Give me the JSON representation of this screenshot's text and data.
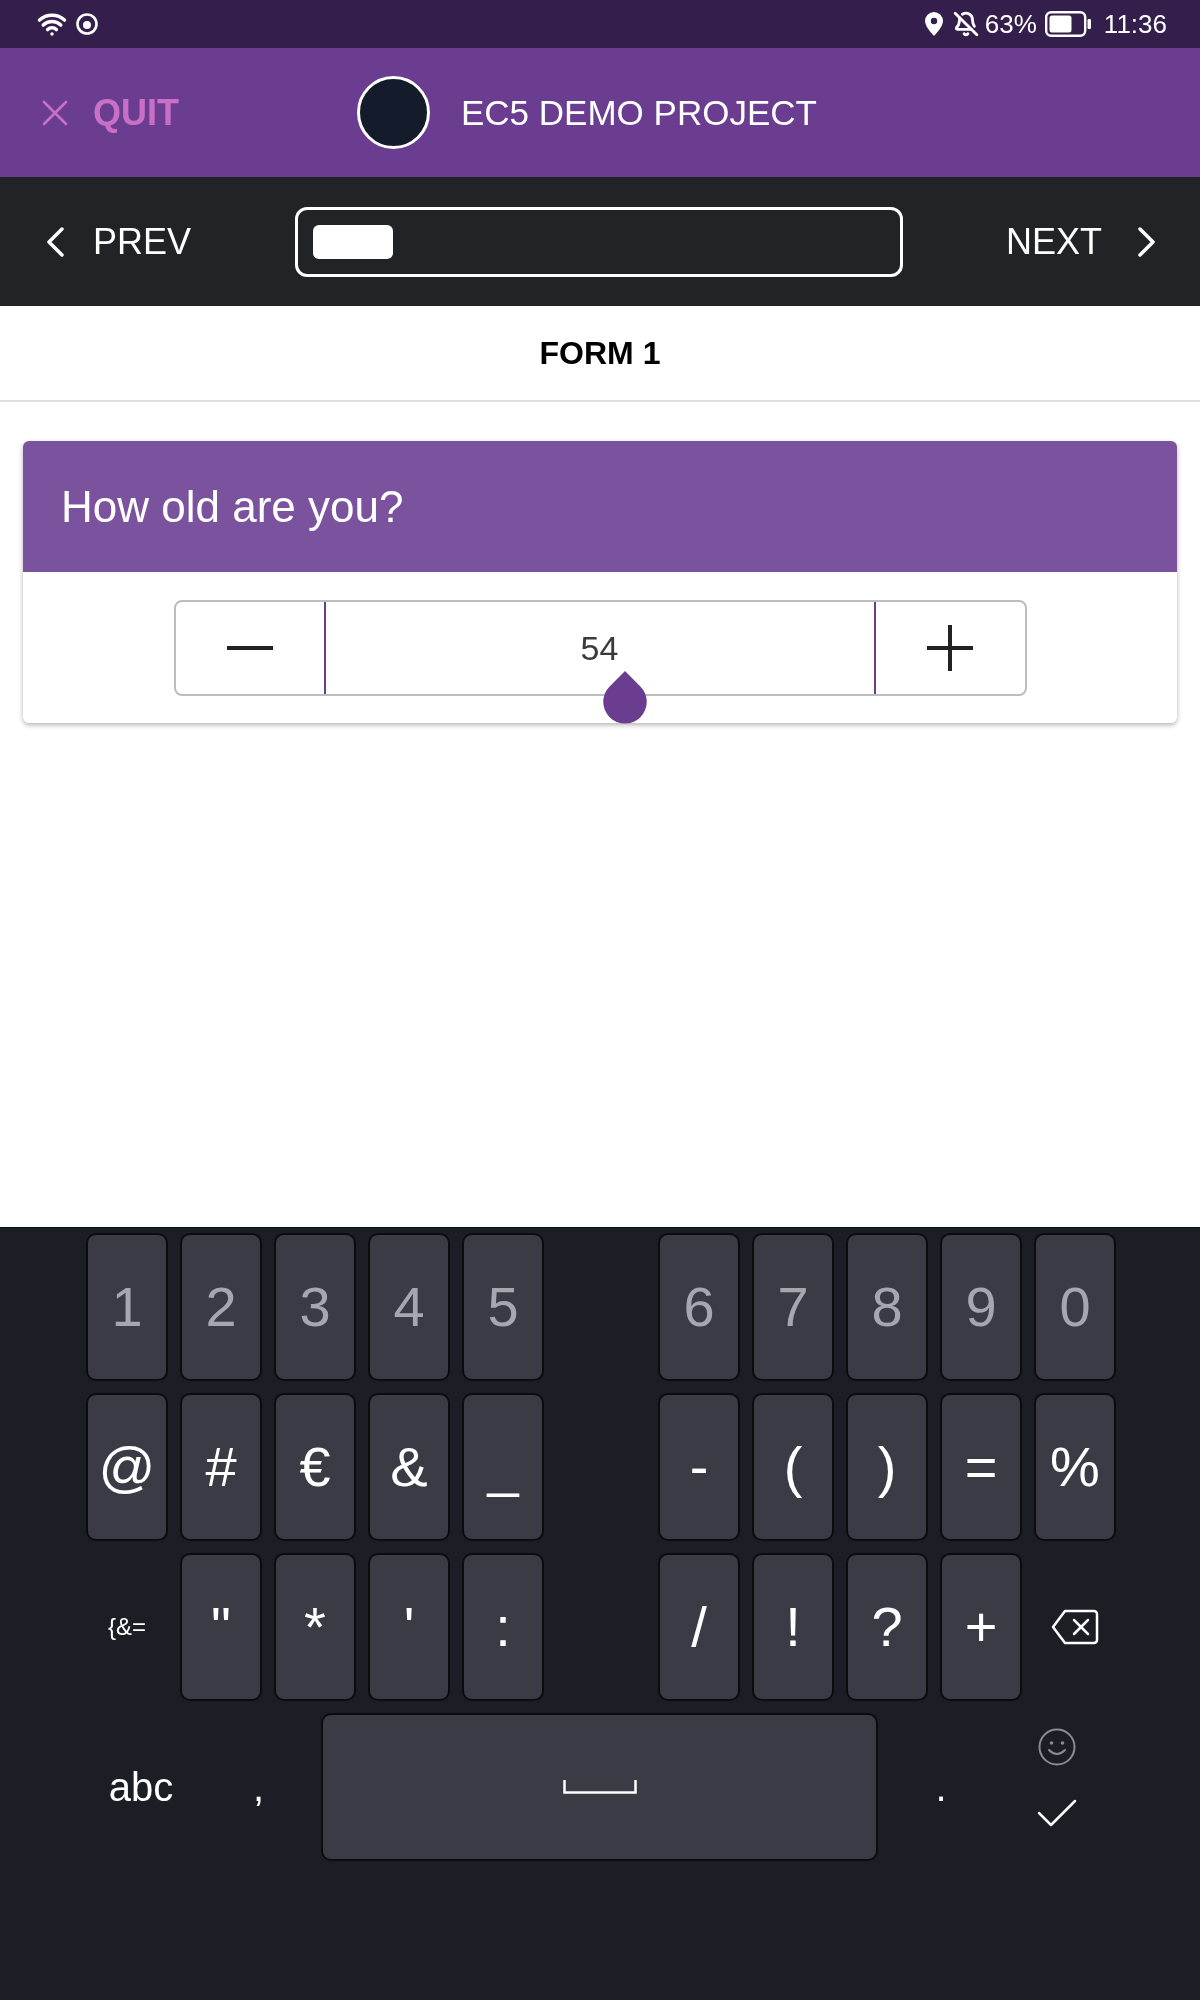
{
  "status_bar": {
    "battery_percent": "63%",
    "time": "11:36"
  },
  "header": {
    "quit_label": "QUIT",
    "title": "EC5 DEMO PROJECT"
  },
  "navigation": {
    "prev_label": "PREV",
    "next_label": "NEXT",
    "progress": {
      "level": 0.14
    }
  },
  "form_title": "FORM 1",
  "question": {
    "text": "How old are you?",
    "value": "54"
  },
  "keyboard": {
    "rows": [
      {
        "left": [
          {
            "kind": "digit",
            "label": "1"
          },
          {
            "kind": "digit",
            "label": "2"
          },
          {
            "kind": "digit",
            "label": "3"
          },
          {
            "kind": "digit",
            "label": "4"
          },
          {
            "kind": "digit",
            "label": "5"
          }
        ],
        "right": [
          {
            "kind": "digit",
            "label": "6"
          },
          {
            "kind": "digit",
            "label": "7"
          },
          {
            "kind": "digit",
            "label": "8"
          },
          {
            "kind": "digit",
            "label": "9"
          },
          {
            "kind": "digit",
            "label": "0"
          }
        ]
      },
      {
        "left": [
          {
            "kind": "symbol",
            "label": "@"
          },
          {
            "kind": "symbol",
            "label": "#"
          },
          {
            "kind": "symbol",
            "label": "€"
          },
          {
            "kind": "symbol",
            "label": "&"
          },
          {
            "kind": "symbol",
            "label": "_"
          }
        ],
        "right": [
          {
            "kind": "symbol",
            "label": "-"
          },
          {
            "kind": "symbol",
            "label": "("
          },
          {
            "kind": "symbol",
            "label": ")"
          },
          {
            "kind": "symbol",
            "label": "="
          },
          {
            "kind": "symbol",
            "label": "%"
          }
        ]
      },
      {
        "left": [
          {
            "kind": "mode_small",
            "label": "{&="
          },
          {
            "kind": "symbol",
            "label": "\""
          },
          {
            "kind": "symbol",
            "label": "*"
          },
          {
            "kind": "symbol",
            "label": "'"
          },
          {
            "kind": "symbol",
            "label": ":"
          }
        ],
        "right": [
          {
            "kind": "symbol",
            "label": "/"
          },
          {
            "kind": "symbol",
            "label": "!"
          },
          {
            "kind": "symbol",
            "label": "?"
          },
          {
            "kind": "symbol",
            "label": "+"
          },
          {
            "kind": "backspace"
          }
        ]
      }
    ],
    "bottom_row": [
      {
        "kind": "text",
        "label": "abc"
      },
      {
        "kind": "text",
        "label": ","
      },
      {
        "kind": "space"
      },
      {
        "kind": "text",
        "label": "."
      },
      {
        "kind": "emoji"
      },
      {
        "kind": "done"
      }
    ]
  }
}
